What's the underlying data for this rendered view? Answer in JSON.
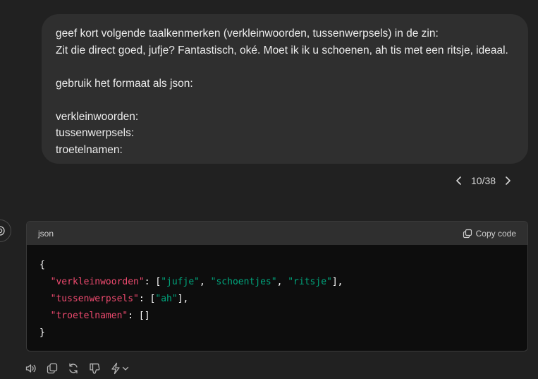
{
  "user_message": {
    "lines": [
      "geef kort volgende taalkenmerken (verkleinwoorden, tussenwerpsels) in de zin:",
      "Zit die direct goed, jufje? Fantastisch, oké. Moet ik ik u schoenen, ah tis met een ritsje, ideaal.",
      "",
      "gebruik het formaat als json:",
      "",
      "verkleinwoorden:",
      "tussenwerpsels:",
      "troetelnamen:"
    ]
  },
  "pager": {
    "label": "10/38"
  },
  "code_block": {
    "language": "json",
    "copy_label": "Copy code",
    "lines": {
      "open": "{",
      "l1": {
        "key": "\"verkleinwoorden\"",
        "colon": ": [",
        "v1": "\"jufje\"",
        "sep1": ", ",
        "v2": "\"schoentjes\"",
        "sep2": ", ",
        "v3": "\"ritsje\"",
        "end": "],"
      },
      "l2": {
        "key": "\"tussenwerpsels\"",
        "colon": ": [",
        "v1": "\"ah\"",
        "end": "],"
      },
      "l3": {
        "key": "\"troetelnamen\"",
        "colon": ": []"
      },
      "close": "}"
    }
  },
  "actions": [
    "read-aloud-icon",
    "copy-icon",
    "regenerate-icon",
    "thumbs-down-icon",
    "model-switch-icon"
  ]
}
